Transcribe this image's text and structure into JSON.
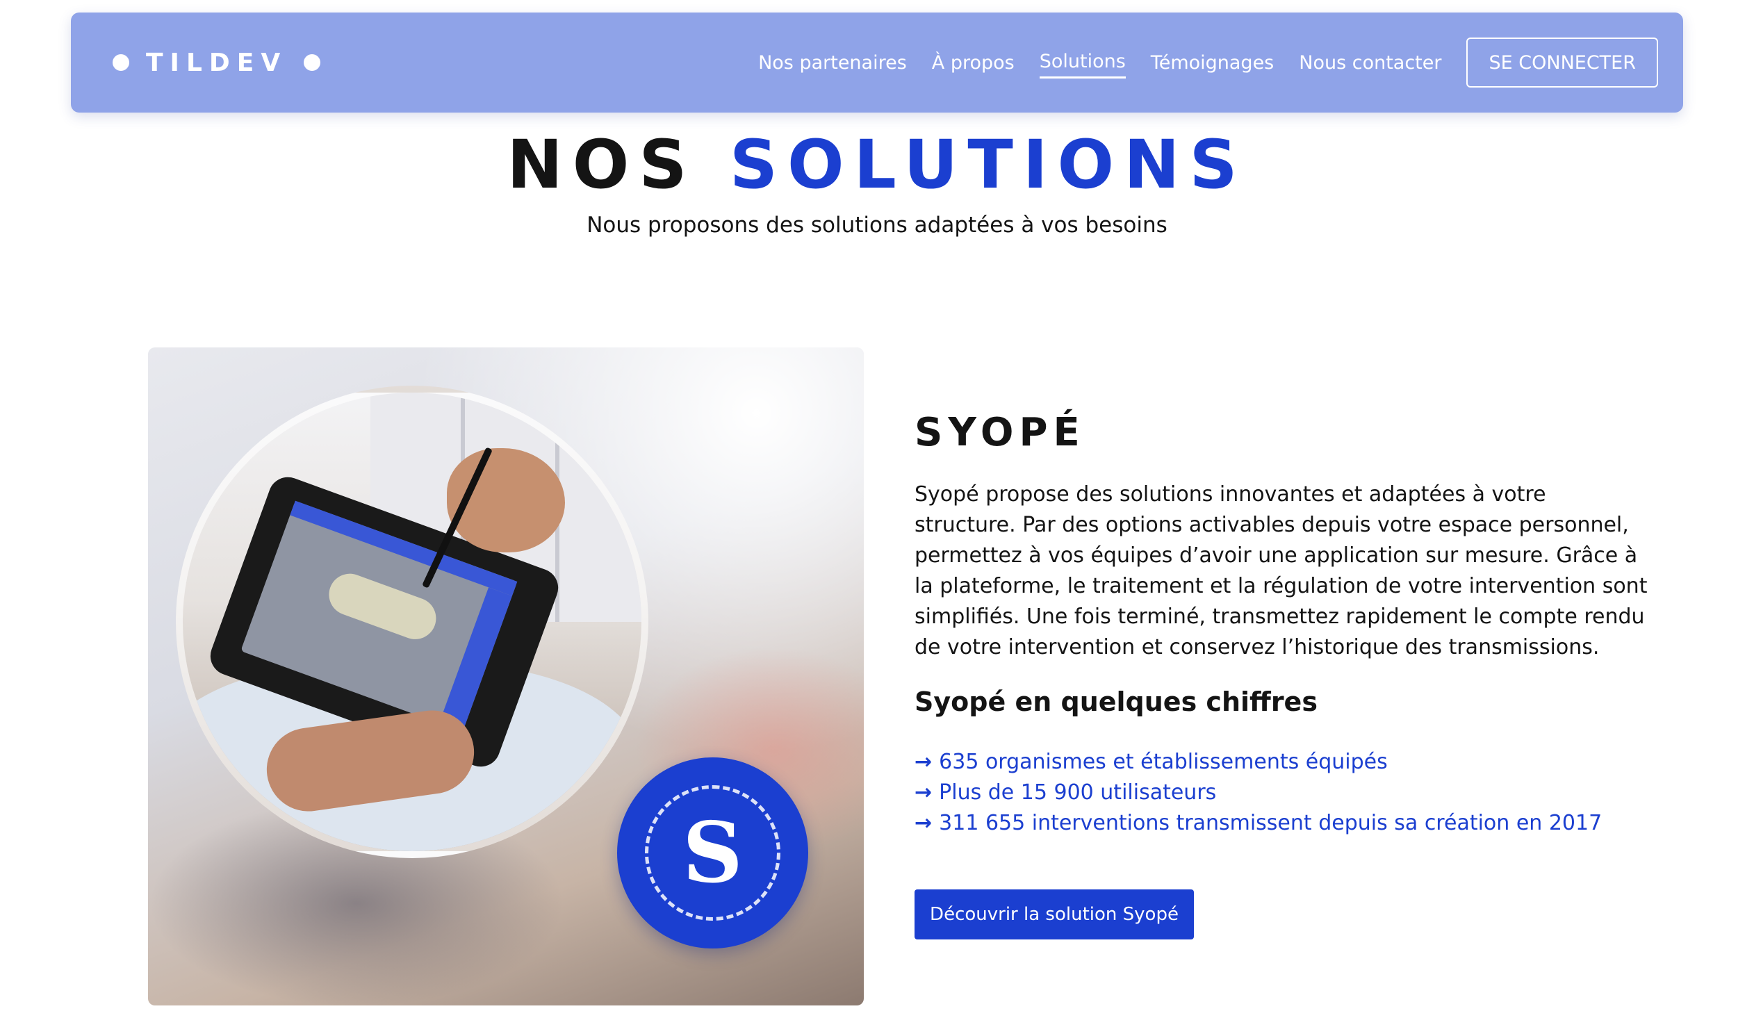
{
  "brand": {
    "name": "TILDEV"
  },
  "nav": {
    "items": [
      {
        "label": "Nos partenaires",
        "active": false
      },
      {
        "label": "À propos",
        "active": false
      },
      {
        "label": "Solutions",
        "active": true
      },
      {
        "label": "Témoignages",
        "active": false
      },
      {
        "label": "Nous contacter",
        "active": false
      }
    ],
    "login_label": "SE CONNECTER"
  },
  "header": {
    "title_part1": "NOS",
    "title_part2": "SOLUTIONS",
    "subtitle": "Nous proposons des solutions adaptées à vos besoins"
  },
  "solution": {
    "badge_letter": "S",
    "title": "SYOPÉ",
    "description": "Syopé propose des solutions innovantes et adaptées à votre structure. Par des options activables depuis votre espace personnel, permettez à vos équipes d’avoir une application sur mesure. Grâce à la plateforme, le traitement et la régulation de votre intervention sont simplifiés. Une fois terminé, transmettez rapidement le compte rendu de votre intervention et conservez l’historique des transmissions.",
    "figures_heading": "Syopé en quelques chiffres",
    "stats": [
      "635 organismes et établissements équipés",
      "Plus de 15 900 utilisateurs",
      "311 655 interventions transmissent depuis sa création en 2017"
    ],
    "cta_label": "Découvrir la solution Syopé"
  },
  "colors": {
    "navbar_bg": "#8fa3e8",
    "accent_blue": "#1b3fd0",
    "text_dark": "#141414",
    "background": "#ffffff"
  },
  "icons": {
    "logo_dots": "circle-dot-icon",
    "stat_bullet": "arrow-right-icon",
    "badge": "syope-logo-icon"
  }
}
